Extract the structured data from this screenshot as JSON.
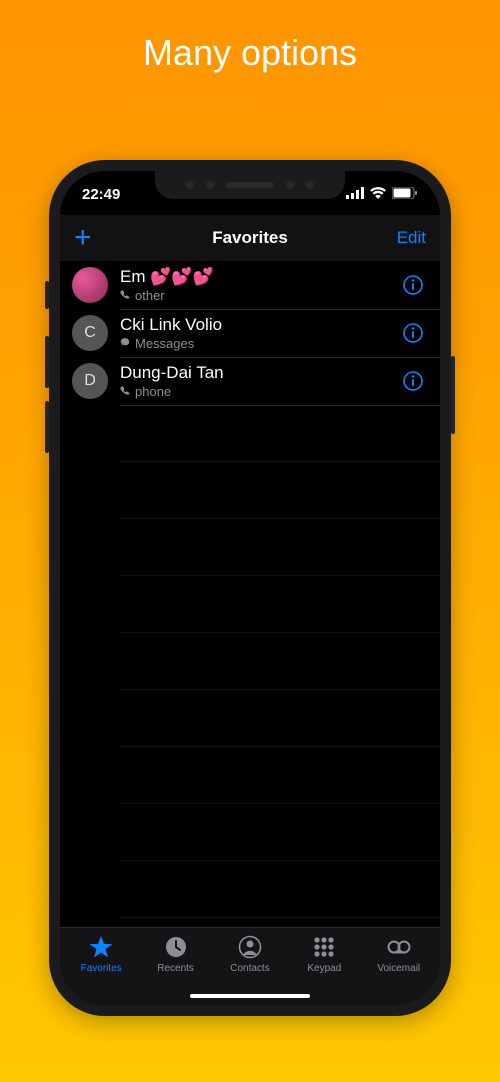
{
  "page_heading": "Many options",
  "statusbar": {
    "time": "22:49"
  },
  "navbar": {
    "title": "Favorites",
    "edit": "Edit"
  },
  "favorites": [
    {
      "name": "Em 💕💕💕",
      "subtype": "other",
      "subicon": "phone",
      "initial": "",
      "photo": true
    },
    {
      "name": "Cki Link Volio",
      "subtype": "Messages",
      "subicon": "message",
      "initial": "C",
      "photo": false
    },
    {
      "name": "Dung-Dai Tan",
      "subtype": "phone",
      "subicon": "phone",
      "initial": "D",
      "photo": false
    }
  ],
  "tabs": [
    {
      "label": "Favorites",
      "active": true
    },
    {
      "label": "Recents",
      "active": false
    },
    {
      "label": "Contacts",
      "active": false
    },
    {
      "label": "Keypad",
      "active": false
    },
    {
      "label": "Voicemail",
      "active": false
    }
  ]
}
